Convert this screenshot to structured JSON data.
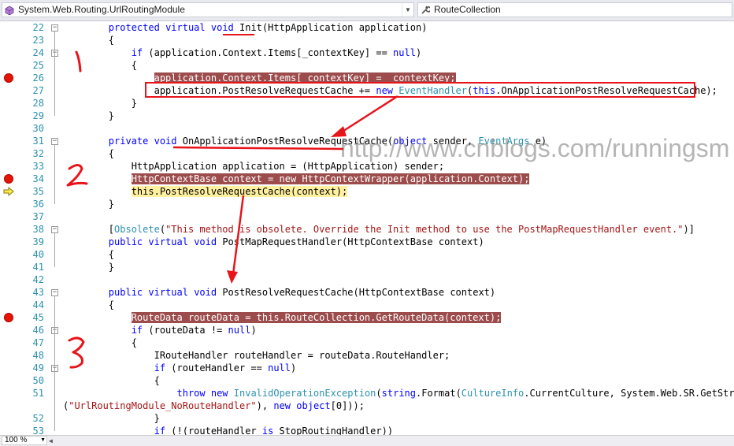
{
  "toolbar": {
    "left_combo": "System.Web.Routing.UrlRoutingModule",
    "right_combo": "RouteCollection"
  },
  "editor": {
    "lines": [
      {
        "n": "22",
        "tokens": [
          [
            "        ",
            ""
          ],
          [
            "protected",
            "k"
          ],
          [
            " ",
            ""
          ],
          [
            "virtual",
            "k"
          ],
          [
            " ",
            ""
          ],
          [
            "void",
            "k"
          ],
          [
            " Init(HttpApplication application)",
            ""
          ]
        ]
      },
      {
        "n": "23",
        "tokens": [
          [
            "        {",
            ""
          ]
        ]
      },
      {
        "n": "24",
        "tokens": [
          [
            "            ",
            ""
          ],
          [
            "if",
            "k"
          ],
          [
            " (application.Context.Items[_contextKey] == ",
            ""
          ],
          [
            "null",
            "k"
          ],
          [
            ")",
            ""
          ]
        ]
      },
      {
        "n": "25",
        "tokens": [
          [
            "            {",
            ""
          ]
        ]
      },
      {
        "n": "26",
        "tokens": [
          [
            "                ",
            ""
          ],
          [
            "application.Context.Items[_contextKey] = _contextKey;",
            "hl"
          ]
        ]
      },
      {
        "n": "27",
        "tokens": [
          [
            "                application.PostResolveRequestCache += ",
            ""
          ],
          [
            "new",
            "k"
          ],
          [
            " ",
            ""
          ],
          [
            "EventHandler",
            "t"
          ],
          [
            "(",
            ""
          ],
          [
            "this",
            "k"
          ],
          [
            ".OnApplicationPostResolveRequestCache);",
            ""
          ]
        ]
      },
      {
        "n": "28",
        "tokens": [
          [
            "            }",
            ""
          ]
        ]
      },
      {
        "n": "29",
        "tokens": [
          [
            "        }",
            ""
          ]
        ]
      },
      {
        "n": "30",
        "tokens": [
          [
            "",
            ""
          ]
        ]
      },
      {
        "n": "31",
        "tokens": [
          [
            "        ",
            ""
          ],
          [
            "private",
            "k"
          ],
          [
            " ",
            ""
          ],
          [
            "void",
            "k"
          ],
          [
            " OnApplicationPostResolveRequestCache(",
            ""
          ],
          [
            "object",
            "k"
          ],
          [
            " sender, ",
            ""
          ],
          [
            "EventArgs",
            "t"
          ],
          [
            " e)",
            ""
          ]
        ]
      },
      {
        "n": "32",
        "tokens": [
          [
            "        {",
            ""
          ]
        ]
      },
      {
        "n": "33",
        "tokens": [
          [
            "            HttpApplication application = (HttpApplication) sender;",
            ""
          ]
        ]
      },
      {
        "n": "34",
        "tokens": [
          [
            "            ",
            ""
          ],
          [
            "HttpContextBase context = new HttpContextWrapper(application.Context);",
            "hl"
          ]
        ]
      },
      {
        "n": "35",
        "tokens": [
          [
            "            ",
            ""
          ],
          [
            "this.PostResolveRequestCache(context);",
            "hly"
          ]
        ]
      },
      {
        "n": "36",
        "tokens": [
          [
            "        }",
            ""
          ]
        ]
      },
      {
        "n": "37",
        "tokens": [
          [
            "",
            ""
          ]
        ]
      },
      {
        "n": "38",
        "tokens": [
          [
            "        [",
            ""
          ],
          [
            "Obsolete",
            "t"
          ],
          [
            "(",
            ""
          ],
          [
            "\"This method is obsolete. Override the Init method to use the PostMapRequestHandler event.\"",
            "s"
          ],
          [
            ")]",
            ""
          ]
        ]
      },
      {
        "n": "39",
        "tokens": [
          [
            "        ",
            ""
          ],
          [
            "public",
            "k"
          ],
          [
            " ",
            ""
          ],
          [
            "virtual",
            "k"
          ],
          [
            " ",
            ""
          ],
          [
            "void",
            "k"
          ],
          [
            " PostMapRequestHandler(HttpContextBase context)",
            ""
          ]
        ]
      },
      {
        "n": "40",
        "tokens": [
          [
            "        {",
            ""
          ]
        ]
      },
      {
        "n": "41",
        "tokens": [
          [
            "        }",
            ""
          ]
        ]
      },
      {
        "n": "42",
        "tokens": [
          [
            "",
            ""
          ]
        ]
      },
      {
        "n": "43",
        "tokens": [
          [
            "        ",
            ""
          ],
          [
            "public",
            "k"
          ],
          [
            " ",
            ""
          ],
          [
            "virtual",
            "k"
          ],
          [
            " ",
            ""
          ],
          [
            "void",
            "k"
          ],
          [
            " PostResolveRequestCache(HttpContextBase context)",
            ""
          ]
        ]
      },
      {
        "n": "44",
        "tokens": [
          [
            "        {",
            ""
          ]
        ]
      },
      {
        "n": "45",
        "tokens": [
          [
            "            ",
            ""
          ],
          [
            "RouteData routeData = this.RouteCollection.GetRouteData(context);",
            "hl"
          ]
        ]
      },
      {
        "n": "46",
        "tokens": [
          [
            "            ",
            ""
          ],
          [
            "if",
            "k"
          ],
          [
            " (routeData != ",
            ""
          ],
          [
            "null",
            "k"
          ],
          [
            ")",
            ""
          ]
        ]
      },
      {
        "n": "47",
        "tokens": [
          [
            "            {",
            ""
          ]
        ]
      },
      {
        "n": "48",
        "tokens": [
          [
            "                IRouteHandler routeHandler = routeData.RouteHandler;",
            ""
          ]
        ]
      },
      {
        "n": "49",
        "tokens": [
          [
            "                ",
            ""
          ],
          [
            "if",
            "k"
          ],
          [
            " (routeHandler == ",
            ""
          ],
          [
            "null",
            "k"
          ],
          [
            ")",
            ""
          ]
        ]
      },
      {
        "n": "50",
        "tokens": [
          [
            "                {",
            ""
          ]
        ]
      },
      {
        "n": "51",
        "tokens": [
          [
            "                    ",
            ""
          ],
          [
            "throw",
            "k"
          ],
          [
            " ",
            ""
          ],
          [
            "new",
            "k"
          ],
          [
            " ",
            ""
          ],
          [
            "InvalidOperationException",
            "t"
          ],
          [
            "(",
            ""
          ],
          [
            "string",
            "k"
          ],
          [
            ".Format(",
            ""
          ],
          [
            "CultureInfo",
            "t"
          ],
          [
            ".CurrentCulture, System.Web.SR.GetString",
            ""
          ]
        ]
      },
      {
        "n": "",
        "tokens": [
          [
            "(",
            ""
          ],
          [
            "\"UrlRoutingModule_NoRouteHandler\"",
            "s"
          ],
          [
            "), ",
            ""
          ],
          [
            "new",
            "k"
          ],
          [
            " ",
            ""
          ],
          [
            "object",
            "k"
          ],
          [
            "[0]));",
            ""
          ]
        ]
      },
      {
        "n": "52",
        "tokens": [
          [
            "                }",
            ""
          ]
        ]
      },
      {
        "n": "53",
        "tokens": [
          [
            "                ",
            ""
          ],
          [
            "if",
            "k"
          ],
          [
            " (!(routeHandler ",
            ""
          ],
          [
            "is",
            "k"
          ],
          [
            " StopRoutingHandler))",
            ""
          ]
        ]
      }
    ]
  },
  "watermark": "http://www.cnblogs.com/runningsm",
  "annotations": {
    "label_1": "1",
    "label_2": "2",
    "label_3": "3"
  },
  "status": {
    "zoom": "100 %"
  },
  "colors": {
    "keyword": "#0000ff",
    "type": "#2b91af",
    "string": "#a31515",
    "breakpoint": "#e51400",
    "breakpoint_line": "#9c4c4c",
    "current_line": "#fff1a0",
    "annotation": "#e8141b"
  }
}
